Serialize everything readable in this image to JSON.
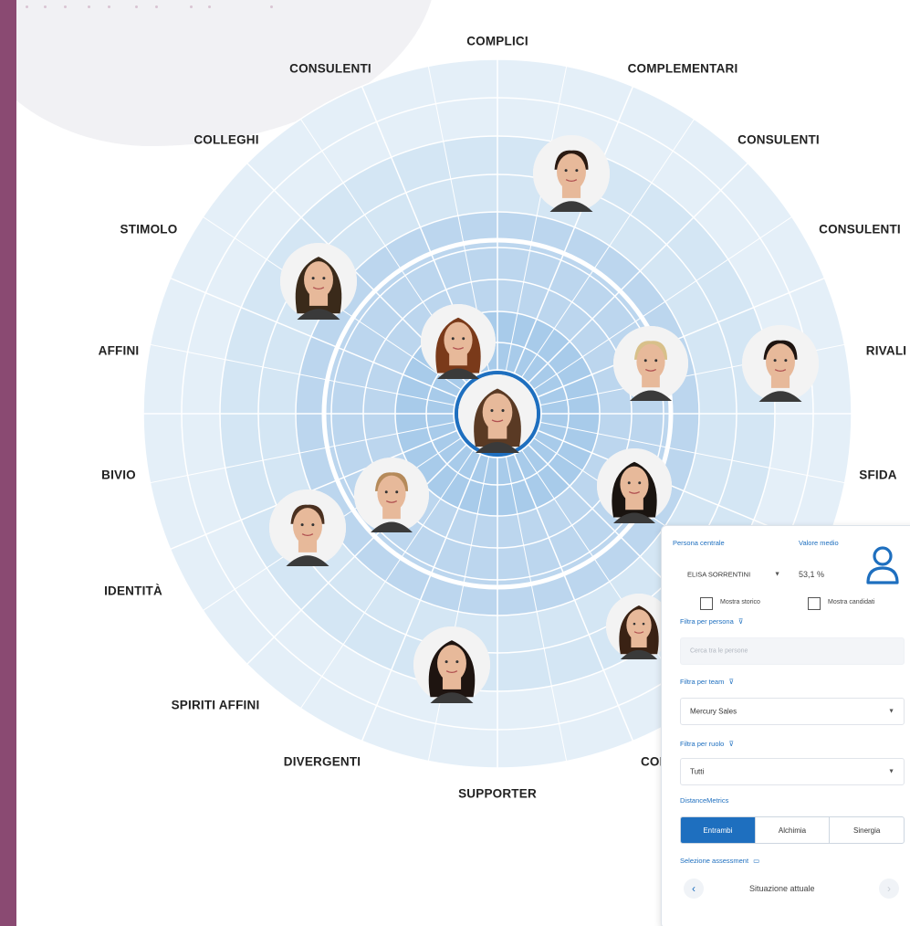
{
  "radar": {
    "segments": [
      "COMPLICI",
      "COMPLEMENTARI",
      "CONSULENTI",
      "CONSULENTI",
      "RIVALI",
      "SFIDA",
      "COM",
      "SUPPORTER",
      "DIVERGENTI",
      "SPIRITI AFFINI",
      "IDENTITÀ",
      "BIVIO",
      "AFFINI",
      "STIMOLO",
      "COLLEGHI",
      "CONSULENTI"
    ],
    "colors": {
      "outer": "#e4eff8",
      "ring": "#d4e6f4",
      "inner": "#bcd6ee",
      "core": "#a8cbea",
      "lines": "#ffffff",
      "accent": "#1e6fbf"
    },
    "avatars": [
      {
        "icon": "person-female-avatar-icon"
      },
      {
        "icon": "person-male-avatar-icon"
      },
      {
        "icon": "person-female-avatar-icon"
      },
      {
        "icon": "person-female-avatar-icon"
      },
      {
        "icon": "person-male-avatar-icon"
      },
      {
        "icon": "person-male-avatar-icon"
      },
      {
        "icon": "person-female-avatar-icon"
      },
      {
        "icon": "person-male-avatar-icon"
      },
      {
        "icon": "person-male-avatar-icon"
      },
      {
        "icon": "person-female-avatar-icon"
      },
      {
        "icon": "person-female-avatar-icon"
      }
    ]
  },
  "panel": {
    "central_label": "Persona centrale",
    "central_value": "ELISA SORRENTINI",
    "avg_label": "Valore medio",
    "avg_value": "53,1 %",
    "show_history": "Mostra storico",
    "show_candidates": "Mostra candidati",
    "filter_person_label": "Filtra per persona",
    "filter_person_placeholder": "Cerca tra le persone",
    "filter_team_label": "Filtra per team",
    "filter_team_value": "Mercury Sales",
    "filter_role_label": "Filtra per ruolo",
    "filter_role_value": "Tutti",
    "metrics_label": "DistanceMetrics",
    "metrics_options": [
      "Entrambi",
      "Alchimia",
      "Sinergia"
    ],
    "assessment_label": "Selezione assessment",
    "assessment_value": "Situazione attuale"
  }
}
